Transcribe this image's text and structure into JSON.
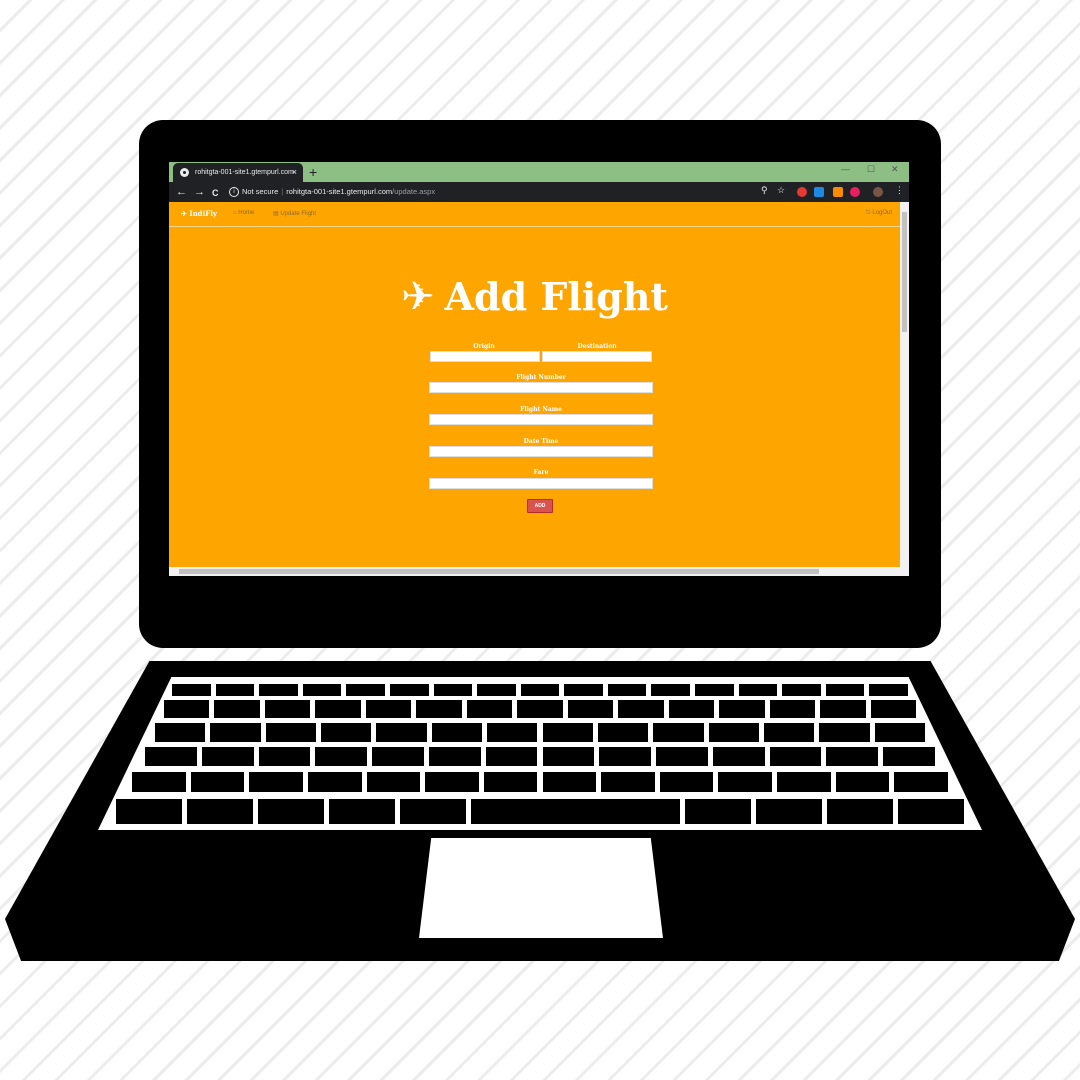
{
  "browser": {
    "tab_title": "rohitgta-001-site1.gtempurl.com",
    "tab_close": "×",
    "new_tab": "+",
    "controls": {
      "minimize": "—",
      "maximize": "☐",
      "close": "✕"
    },
    "nav": {
      "back": "←",
      "forward": "→",
      "reload": "C"
    },
    "security_label": "Not secure",
    "url_host": "rohitgta-001-site1.gtempurl.com",
    "url_path": "/update.aspx",
    "extension_colors": [
      "#e53935",
      "#1e88e5",
      "#fb8c00",
      "#e91e63"
    ]
  },
  "site": {
    "brand": "IndiFly",
    "nav": {
      "home": "Home",
      "update_flight": "Update Flight",
      "logout": "LogOut"
    }
  },
  "form": {
    "title": "Add Flight",
    "origin_label": "Origin",
    "destination_label": "Destination",
    "flight_number_label": "Flight Number",
    "flight_name_label": "Flight Name",
    "date_time_label": "Date Time",
    "fare_label": "Fare",
    "add_button": "ADD"
  },
  "colors": {
    "page_bg": "#ffa500",
    "tab_strip": "#8dbf84",
    "add_button": "#d9534f"
  }
}
